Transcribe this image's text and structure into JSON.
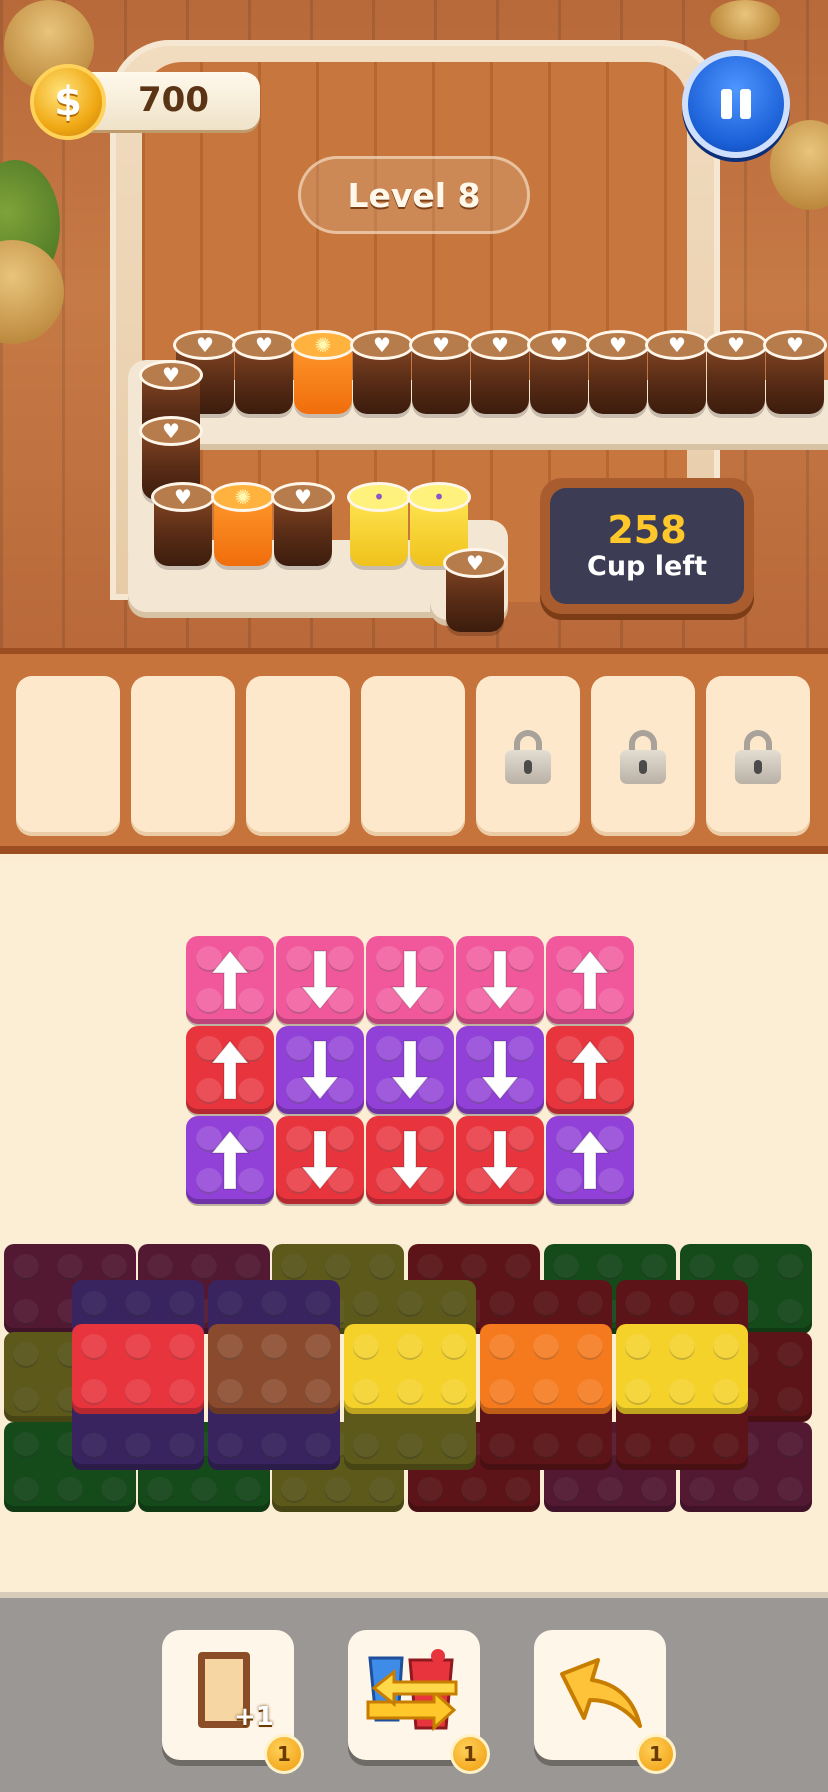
{
  "hud": {
    "coins": "700",
    "coin_symbol": "$",
    "level": "Level 8",
    "cups_left_count": "258",
    "cups_left_label": "Cup left"
  },
  "conveyor_cups": [
    "latte",
    "latte",
    "orange-juice",
    "latte",
    "latte",
    "latte",
    "latte",
    "latte",
    "latte",
    "latte",
    "latte",
    "latte",
    "latte",
    "latte",
    "orange-juice",
    "latte",
    "lemonade",
    "lemonade",
    "latte"
  ],
  "slots": [
    {
      "locked": false
    },
    {
      "locked": false
    },
    {
      "locked": false
    },
    {
      "locked": false
    },
    {
      "locked": true
    },
    {
      "locked": true
    },
    {
      "locked": true
    }
  ],
  "arrow_grid": {
    "rows": [
      [
        {
          "color": "pink",
          "dir": "up"
        },
        {
          "color": "pink",
          "dir": "down"
        },
        {
          "color": "pink",
          "dir": "down"
        },
        {
          "color": "pink",
          "dir": "down"
        },
        {
          "color": "pink",
          "dir": "up"
        }
      ],
      [
        {
          "color": "red",
          "dir": "up"
        },
        {
          "color": "purple",
          "dir": "down"
        },
        {
          "color": "purple",
          "dir": "down"
        },
        {
          "color": "purple",
          "dir": "down"
        },
        {
          "color": "red",
          "dir": "up"
        }
      ],
      [
        {
          "color": "purple",
          "dir": "up"
        },
        {
          "color": "red",
          "dir": "down"
        },
        {
          "color": "red",
          "dir": "down"
        },
        {
          "color": "red",
          "dir": "down"
        },
        {
          "color": "purple",
          "dir": "up"
        }
      ]
    ]
  },
  "brick_stack": {
    "front_colors": [
      "red",
      "brown",
      "yellow",
      "orange",
      "yellow"
    ]
  },
  "boosters": [
    {
      "icon": "extra-slot-icon",
      "badge": "1",
      "extra": "+1"
    },
    {
      "icon": "swap-cups-icon",
      "badge": "1"
    },
    {
      "icon": "undo-arrow-icon",
      "badge": "1"
    }
  ],
  "colors": {
    "pink": "#f1589b",
    "red": "#e8343d",
    "purple": "#9140d8",
    "brown": "#8a4a2d",
    "yellow": "#f5d22a",
    "orange": "#f57a1e",
    "accent_blue": "#1a5fd6",
    "gold": "#ffc72a"
  }
}
